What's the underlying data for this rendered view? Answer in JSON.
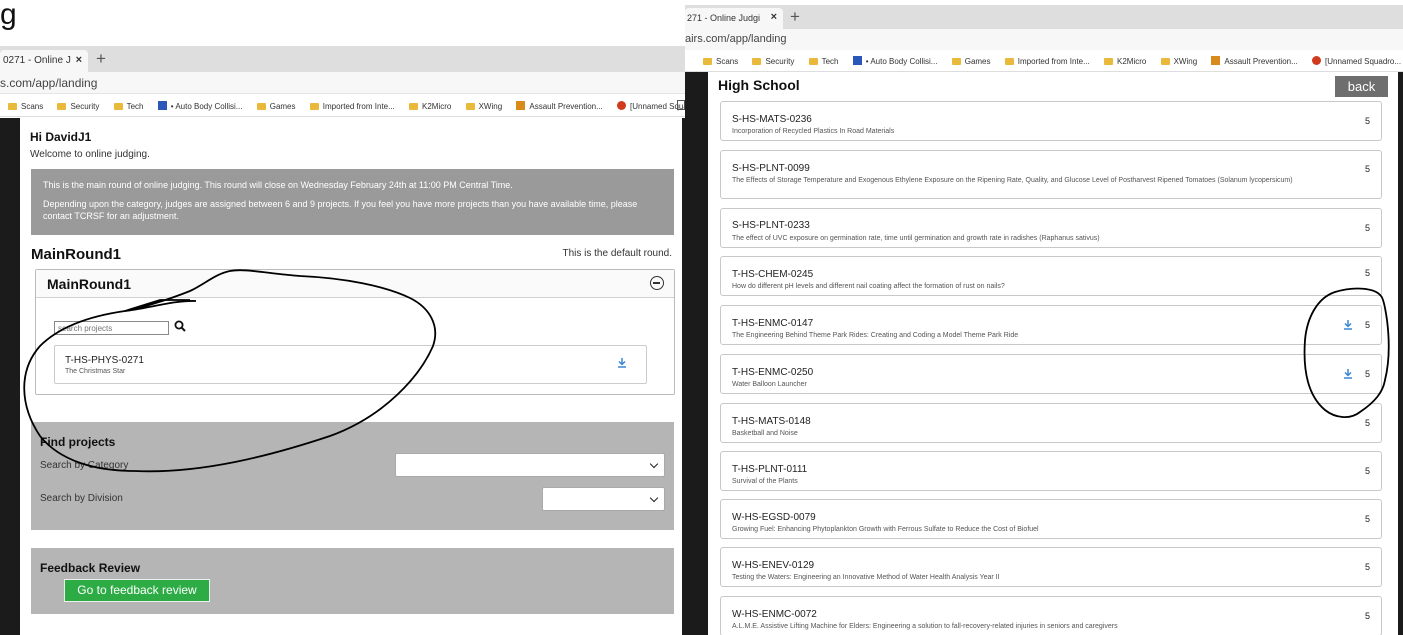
{
  "top_label": "g",
  "left": {
    "tab": {
      "title": "0271 - Online J",
      "close": "×"
    },
    "new_tab": "+",
    "url": "s.com/app/landing",
    "bookmarks": [
      {
        "label": "Scans",
        "icon": "folder"
      },
      {
        "label": "Security",
        "icon": "folder"
      },
      {
        "label": "Tech",
        "icon": "folder"
      },
      {
        "label": "• Auto Body Collisi...",
        "icon": "blue-tile"
      },
      {
        "label": "Games",
        "icon": "folder"
      },
      {
        "label": "Imported from Inte...",
        "icon": "folder"
      },
      {
        "label": "K2Micro",
        "icon": "folder"
      },
      {
        "label": "XWing",
        "icon": "folder"
      },
      {
        "label": "Assault Prevention...",
        "icon": "orange-tile"
      },
      {
        "label": "[Unnamed Squadro...",
        "icon": "red-circle"
      }
    ],
    "greeting": "Hi DavidJ1",
    "welcome": "Welcome to online judging.",
    "notice": [
      "This is the main round of online judging.  This round will close on Wednesday February 24th at 11:00 PM Central Time.",
      "Depending upon the category, judges are assigned between 6 and 9 projects.  If you feel you have more projects than you have available time, please contact TCRSF for an adjustment."
    ],
    "round": {
      "title": "MainRound1",
      "default_note": "This is the default round.",
      "box_title": "MainRound1",
      "search_placeholder": "search projects",
      "project": {
        "code": "T-HS-PHYS-0271",
        "title": "The Christmas Star"
      }
    },
    "find": {
      "title": "Find projects",
      "by_category": "Search by Category",
      "by_division": "Search by Division",
      "category_value": "",
      "division_value": ""
    },
    "feedback": {
      "title": "Feedback Review",
      "button": "Go to feedback review"
    }
  },
  "right": {
    "tab": {
      "title": "271 - Online Judgi",
      "close": "×"
    },
    "new_tab": "+",
    "url": "airs.com/app/landing",
    "bookmarks": [
      {
        "label": "Scans",
        "icon": "folder"
      },
      {
        "label": "Security",
        "icon": "folder"
      },
      {
        "label": "Tech",
        "icon": "folder"
      },
      {
        "label": "• Auto Body Collisi...",
        "icon": "blue-tile"
      },
      {
        "label": "Games",
        "icon": "folder"
      },
      {
        "label": "Imported from Inte...",
        "icon": "folder"
      },
      {
        "label": "K2Micro",
        "icon": "folder"
      },
      {
        "label": "XWing",
        "icon": "folder"
      },
      {
        "label": "Assault Prevention...",
        "icon": "orange-tile"
      },
      {
        "label": "[Unnamed Squadro...",
        "icon": "red-circle"
      }
    ],
    "section_title": "High School",
    "back": "back",
    "projects": [
      {
        "code": "S-HS-MATS-0236",
        "desc": "Incorporation of Recycled Plastics In Road Materials",
        "score": "5",
        "download": false
      },
      {
        "code": "S-HS-PLNT-0099",
        "desc": "The Effects of Storage Temperature and Exogenous Ethylene Exposure on the Ripening Rate, Quality, and Glucose Level of Postharvest Ripened Tomatoes (Solanum lycopersicum)",
        "score": "5",
        "download": false
      },
      {
        "code": "S-HS-PLNT-0233",
        "desc": "The effect of UVC exposure on germination rate, time until germination and growth rate in radishes (Raphanus sativus)",
        "score": "5",
        "download": false
      },
      {
        "code": "T-HS-CHEM-0245",
        "desc": "How do different pH levels and different nail coating affect the formation of rust on nails?",
        "score": "5",
        "download": false
      },
      {
        "code": "T-HS-ENMC-0147",
        "desc": "The Engineering Behind Theme Park Rides: Creating and Coding a Model Theme Park Ride",
        "score": "5",
        "download": true
      },
      {
        "code": "T-HS-ENMC-0250",
        "desc": "Water Balloon Launcher",
        "score": "5",
        "download": true
      },
      {
        "code": "T-HS-MATS-0148",
        "desc": "Basketball and Noise",
        "score": "5",
        "download": false
      },
      {
        "code": "T-HS-PLNT-0111",
        "desc": "Survival of the Plants",
        "score": "5",
        "download": false
      },
      {
        "code": "W-HS-EGSD-0079",
        "desc": "Growing Fuel: Enhancing Phytoplankton Growth with Ferrous Sulfate to Reduce the Cost of Biofuel",
        "score": "5",
        "download": false
      },
      {
        "code": "W-HS-ENEV-0129",
        "desc": "Testing the Waters: Engineering an Innovative Method of Water Health Analysis Year II",
        "score": "5",
        "download": false
      },
      {
        "code": "W-HS-ENMC-0072",
        "desc": "A.L.M.E. Assistive Lifting Machine for Elders: Engineering a solution to fall-recovery-related injuries in seniors and caregivers",
        "score": "5",
        "download": false
      }
    ]
  }
}
